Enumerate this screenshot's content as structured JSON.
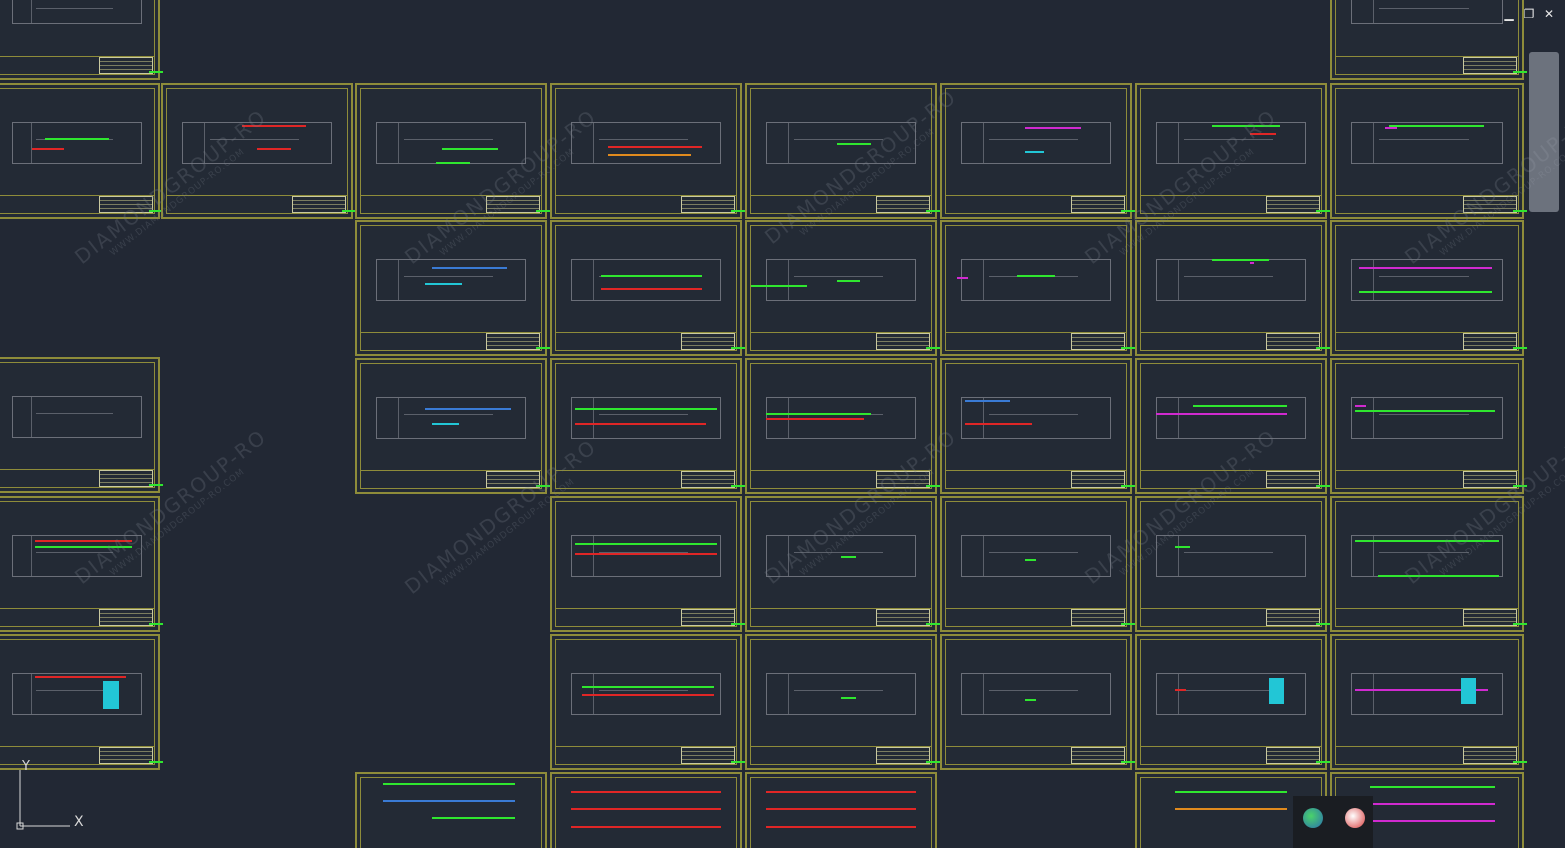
{
  "viewport": {
    "background": "#222834",
    "sheet_border_color": "#8e8c3a"
  },
  "watermark": {
    "text": "DIAMONDGROUP-RO",
    "subtext": "WWW.DIAMONDGROUP-RO.COM"
  },
  "window_controls": {
    "minimize_icon": "minimize-icon",
    "restore_icon": "restore-icon",
    "close_icon": "close-icon",
    "minimize_glyph": "▁",
    "restore_glyph": "❐",
    "close_glyph": "✕"
  },
  "ucs": {
    "x_label": "X",
    "y_label": "Y"
  },
  "colors": {
    "green": "#2fe62f",
    "red": "#e02626",
    "magenta": "#d02ad0",
    "cyan": "#22c6d6",
    "blue": "#3a7bd5",
    "orange": "#e08a1e"
  },
  "sheets": [
    {
      "pipes": "green"
    },
    {
      "pipes": "red"
    },
    {
      "pipes": "green"
    },
    {
      "pipes": "red"
    },
    {
      "pipes": "green"
    },
    {
      "pipes": "magenta"
    },
    {
      "pipes": "green"
    },
    {
      "pipes": "green"
    }
  ]
}
